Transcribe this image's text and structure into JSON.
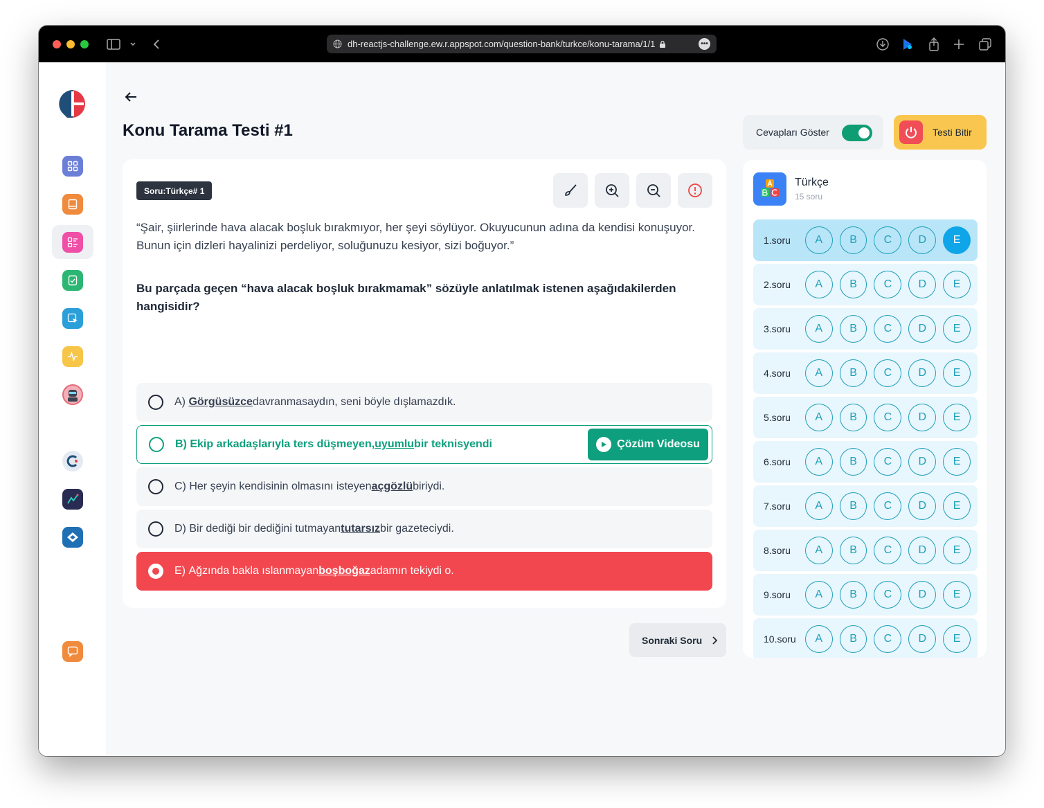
{
  "browser": {
    "url": "dh-reactjs-challenge.ew.r.appspot.com/question-bank/turkce/konu-tarama/1/1"
  },
  "page": {
    "title": "Konu Tarama Testi #1",
    "show_answers_label": "Cevapları Göster",
    "show_answers_on": true,
    "finish_label": "Testi Bitir",
    "next_label": "Sonraki Soru"
  },
  "question": {
    "badge": "Soru:Türkçe# 1",
    "passage": "“Şair, şiirlerinde hava alacak boşluk bırakmıyor, her şeyi söylüyor. Okuyucunun adına da kendisi konuşuyor. Bunun için dizleri hayalinizi perdeliyor, soluğunuzu kesiyor, sizi boğuyor.”",
    "prompt": "Bu parçada geçen “hava alacak boşluk bırakmamak” sözüyle anlatılmak istenen aşağıdakilerden hangisidir?",
    "options": [
      {
        "letter": "A)",
        "bold": "Görgüsüzce",
        "pre": "",
        "post": " davranmasaydın, seni böyle dışlamazdık.",
        "state": "default"
      },
      {
        "letter": "B)",
        "bold": "uyumlu",
        "pre": "Ekip arkadaşlarıyla ters düşmeyen, ",
        "post": " bir teknisyendi",
        "state": "correct"
      },
      {
        "letter": "C)",
        "bold": "açgözlü",
        "pre": "Her şeyin kendisinin olmasını isteyen ",
        "post": " biriydi.",
        "state": "default"
      },
      {
        "letter": "D)",
        "bold": "tutarsız",
        "pre": "Bir dediği bir dediğini tutmayan ",
        "post": " bir gazeteciydi.",
        "state": "default"
      },
      {
        "letter": "E)",
        "bold": "boşboğaz",
        "pre": "Ağzında bakla ıslanmayan ",
        "post": " adamın tekiydi o.",
        "state": "selected-wrong"
      }
    ],
    "video_label": "Çözüm Videosu"
  },
  "answer_panel": {
    "subject": "Türkçe",
    "count": "15 soru",
    "rows": [
      {
        "label": "1.soru",
        "selected": "E"
      },
      {
        "label": "2.soru",
        "selected": ""
      },
      {
        "label": "3.soru",
        "selected": ""
      },
      {
        "label": "4.soru",
        "selected": ""
      },
      {
        "label": "5.soru",
        "selected": ""
      },
      {
        "label": "6.soru",
        "selected": ""
      },
      {
        "label": "7.soru",
        "selected": ""
      },
      {
        "label": "8.soru",
        "selected": ""
      },
      {
        "label": "9.soru",
        "selected": ""
      },
      {
        "label": "10.soru",
        "selected": ""
      }
    ],
    "choices": [
      "A",
      "B",
      "C",
      "D",
      "E"
    ]
  },
  "colors": {
    "accent_green": "#0e9f7e",
    "wrong_red": "#f2474f",
    "finish_yellow": "#f9c74f",
    "answer_blue": "#0ea5e9"
  },
  "icons": {
    "sidebar": [
      "grid-icon",
      "book-icon",
      "list-icon",
      "document-check-icon",
      "cursor-icon",
      "activity-icon",
      "avatar-icon",
      "c-logo-icon",
      "chart-logo-icon",
      "layers-logo-icon",
      "chat-icon"
    ],
    "tools": [
      "brush-icon",
      "zoom-in-icon",
      "zoom-out-icon",
      "alert-icon"
    ]
  }
}
